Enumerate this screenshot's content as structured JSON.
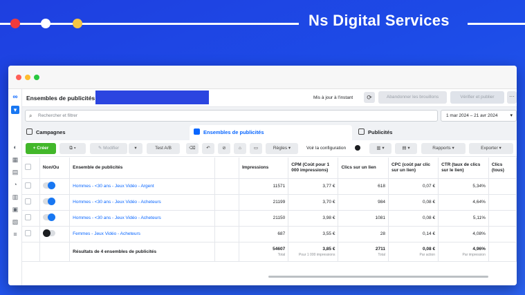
{
  "banner": {
    "brand": "Ns Digital Services",
    "dot_colors": [
      "#ef3b3b",
      "#ffffff",
      "#f6c544"
    ]
  },
  "header": {
    "title": "Ensembles de publicités",
    "update_status": "Mis à jour à l'instant",
    "discard_label": "Abandonner les brouillons",
    "publish_label": "Vérifier et publier",
    "more_label": "···"
  },
  "search": {
    "placeholder": "Rechercher et filtrer",
    "date_range": "1 mar 2024 – 21 avr 2024"
  },
  "tabs": [
    {
      "label": "Campagnes",
      "active": false
    },
    {
      "label": "Ensembles de publicités",
      "active": true
    },
    {
      "label": "Publicités",
      "active": false
    }
  ],
  "toolbar": {
    "create_label": "+ Créer",
    "edit_label": "✎ Modifier",
    "ab_test_label": "Test A/B",
    "rules_label": "Règles ▾",
    "config_label": "Voir la configuration",
    "reports_label": "Rapports ▾",
    "export_label": "Exporter ▾"
  },
  "table": {
    "columns": [
      "Non/Ou",
      "Ensemble de publicités",
      "Impressions",
      "CPM (Coût pour 1 000 impressions)",
      "Clics sur un lien",
      "CPC (coût par clic sur un lien)",
      "CTR (taux de clics sur le lien)",
      "Clics (tous)"
    ],
    "rows": [
      {
        "on": true,
        "name": "Hommes - <30 ans - Jeux Vidéo - Argent",
        "impressions": "11571",
        "cpm": "3,77 €",
        "clicks": "618",
        "cpc": "0,07 €",
        "ctr": "5,34%"
      },
      {
        "on": true,
        "name": "Hommes - <30 ans - Jeux Vidéo - Acheteurs",
        "impressions": "21199",
        "cpm": "3,70 €",
        "clicks": "984",
        "cpc": "0,08 €",
        "ctr": "4,64%"
      },
      {
        "on": true,
        "name": "Hommes - <30 ans - Jeux Vidéo - Acheteurs",
        "impressions": "21150",
        "cpm": "3,98 €",
        "clicks": "1081",
        "cpc": "0,08 €",
        "ctr": "5,11%"
      },
      {
        "on": false,
        "name": "Femmes - Jeux Vidéo - Acheteurs",
        "impressions": "687",
        "cpm": "3,55 €",
        "clicks": "28",
        "cpc": "0,14 €",
        "ctr": "4,08%"
      }
    ],
    "total": {
      "label": "Résultats de 4 ensembles de publicités",
      "impressions": "54607",
      "impressions_sub": "Total",
      "cpm": "3,85 €",
      "cpm_sub": "Pour 1 000 impressions",
      "clicks": "2711",
      "clicks_sub": "Total",
      "cpc": "0,08 €",
      "cpc_sub": "Par action",
      "ctr": "4,96%",
      "ctr_sub": "Par impression"
    }
  },
  "colors": {
    "background": "#1e3fe0",
    "accent": "#0866ff",
    "create": "#42b72a"
  }
}
